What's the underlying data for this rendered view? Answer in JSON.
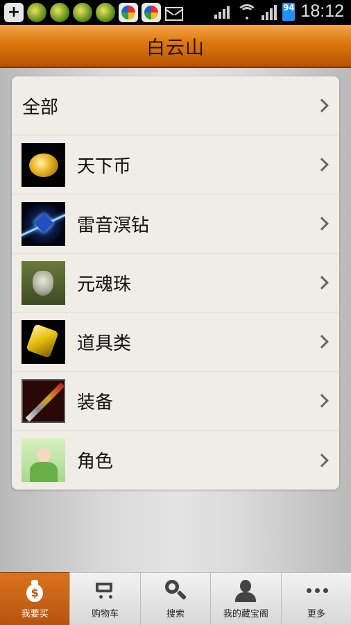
{
  "status_bar": {
    "time": "18:12",
    "battery": "94",
    "icons": [
      "plus-icon",
      "game-app-icon",
      "game-app-icon-2",
      "game-app-icon-3",
      "game-app-icon-4",
      "bag-app-icon",
      "bag-app-icon-2",
      "mail-icon",
      "mute-icon",
      "wifi-icon",
      "signal-icon",
      "battery-icon"
    ]
  },
  "header": {
    "title": "白云山"
  },
  "categories": [
    {
      "label": "全部",
      "thumb": null
    },
    {
      "label": "天下币",
      "thumb": "gold-coin"
    },
    {
      "label": "雷音溟钻",
      "thumb": "blue-gem"
    },
    {
      "label": "元魂珠",
      "thumb": "soul-mask"
    },
    {
      "label": "道具类",
      "thumb": "yellow-crystal"
    },
    {
      "label": "装备",
      "thumb": "weapon"
    },
    {
      "label": "角色",
      "thumb": "character"
    }
  ],
  "tabs": [
    {
      "label": "我要买",
      "icon": "moneybag-icon",
      "active": true
    },
    {
      "label": "购物车",
      "icon": "cart-icon",
      "active": false
    },
    {
      "label": "搜索",
      "icon": "search-icon",
      "active": false
    },
    {
      "label": "我的藏宝阁",
      "icon": "person-icon",
      "active": false
    },
    {
      "label": "更多",
      "icon": "more-icon",
      "active": false
    }
  ],
  "colors": {
    "accent": "#e07a10",
    "tab_active": "#c45e14"
  }
}
